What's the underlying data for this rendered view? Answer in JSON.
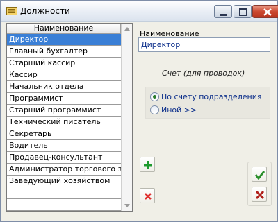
{
  "window": {
    "title": "Должности",
    "icon": "folder-list-icon",
    "controls": [
      "minimize",
      "maximize",
      "close"
    ]
  },
  "list": {
    "column_header": "Наименование",
    "selected_index": 0,
    "rows": [
      "Директор",
      "Главный бухгалтер",
      "Старший кассир",
      "Кассир",
      "Начальник отдела",
      "Программист",
      "Старший программист",
      "Технический писатель",
      "Секретарь",
      "Водитель",
      "Продавец-консультант",
      "Администратор торгового зала",
      "Заведующий хозяйством",
      "",
      ""
    ]
  },
  "form": {
    "name_label": "Наименование",
    "name_value": "Директор",
    "account_group_title": "Счет (для проводок)",
    "account_options": [
      {
        "label": "По счету подразделения",
        "selected": true
      },
      {
        "label": "Иной >>",
        "selected": false
      }
    ]
  },
  "buttons": {
    "add": "plus-icon",
    "delete": "x-icon",
    "ok": "checkmark-icon",
    "cancel": "x-icon"
  },
  "colors": {
    "selection": "#3a7fd6",
    "value_text": "#0b2e8a",
    "add_green": "#1e9a2e",
    "delete_red": "#e03030",
    "ok_green": "#2b8f2b",
    "cancel_red": "#b0201a"
  }
}
